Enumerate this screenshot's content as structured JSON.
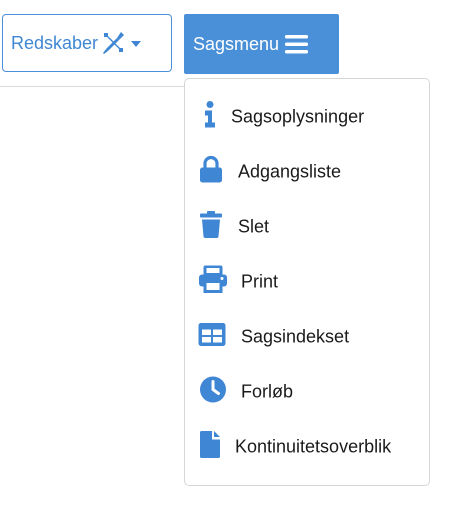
{
  "toolbar": {
    "tools_button": {
      "label": "Redskaber",
      "icon": "tools-icon",
      "caret": "chevron-down-icon"
    },
    "case_menu_button": {
      "label": "Sagsmenu",
      "icon": "bars-icon"
    }
  },
  "dropdown": {
    "items": [
      {
        "label": "Sagsoplysninger",
        "icon": "info-icon"
      },
      {
        "label": "Adgangsliste",
        "icon": "lock-icon"
      },
      {
        "label": "Slet",
        "icon": "trash-icon"
      },
      {
        "label": "Print",
        "icon": "print-icon"
      },
      {
        "label": "Sagsindekset",
        "icon": "table-icon"
      },
      {
        "label": "Forløb",
        "icon": "clock-icon"
      },
      {
        "label": "Kontinuitetsoverblik",
        "icon": "file-icon"
      }
    ]
  },
  "colors": {
    "accent": "#4a90d9",
    "icon": "#3f87d4",
    "text": "#1a1a1a",
    "border": "#d6d6d6"
  }
}
